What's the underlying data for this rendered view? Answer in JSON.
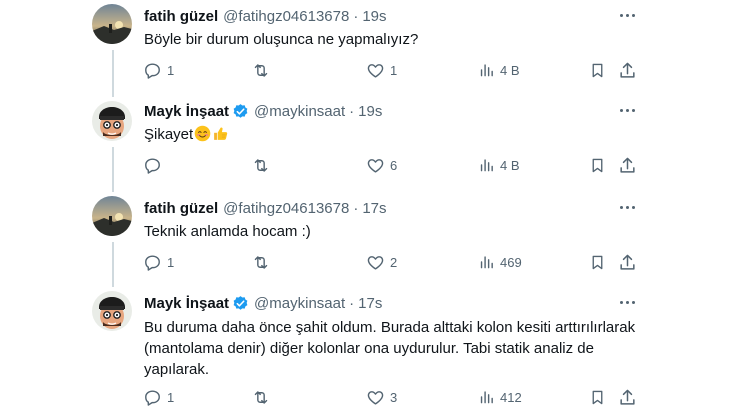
{
  "tweets": [
    {
      "name": "fatih güzel",
      "handle": "@fatihgz04613678",
      "sep": "·",
      "time": "19s",
      "verified": false,
      "avatar": "sunset-landscape-avatar",
      "text": "Böyle bir durum oluşunca ne yapmalıyız?",
      "replies": "1",
      "retweets": "",
      "likes": "1",
      "views": "4 B"
    },
    {
      "name": "Mayk İnşaat",
      "handle": "@maykinsaat",
      "sep": "·",
      "time": "19s",
      "verified": true,
      "avatar": "cartoon-builder-avatar",
      "text": "Şikayet",
      "emojis": [
        "smiling-face-emoji",
        "thumbs-up-emoji"
      ],
      "replies": "",
      "retweets": "",
      "likes": "6",
      "views": "4 B"
    },
    {
      "name": "fatih güzel",
      "handle": "@fatihgz04613678",
      "sep": "·",
      "time": "17s",
      "verified": false,
      "avatar": "sunset-landscape-avatar",
      "text": "Teknik anlamda hocam :)",
      "replies": "1",
      "retweets": "",
      "likes": "2",
      "views": "469"
    },
    {
      "name": "Mayk İnşaat",
      "handle": "@maykinsaat",
      "sep": "·",
      "time": "17s",
      "verified": true,
      "avatar": "cartoon-builder-avatar",
      "text": "Bu duruma daha önce şahit oldum. Burada alttaki kolon kesiti arttırılırlarak (mantolama denir) diğer kolonlar ona uydurulur. Tabi statik analiz de yapılarak.",
      "replies": "1",
      "retweets": "",
      "likes": "3",
      "views": "412"
    }
  ],
  "colors": {
    "text": "#0f1419",
    "muted": "#536471",
    "verified": "#1d9bf0",
    "thread_line": "#cfd9de"
  },
  "icons": [
    "reply-icon",
    "retweet-icon",
    "like-icon",
    "views-icon",
    "bookmark-icon",
    "share-icon",
    "more-icon",
    "verified-badge-icon"
  ]
}
